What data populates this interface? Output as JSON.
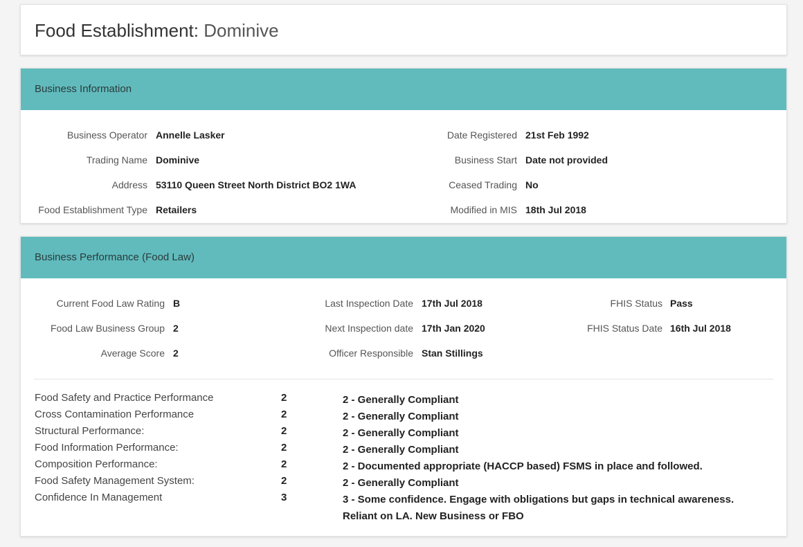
{
  "page": {
    "title_prefix": "Food Establishment:",
    "title_name": "Dominive"
  },
  "business_info": {
    "heading": "Business Information",
    "left": [
      {
        "label": "Business Operator",
        "value": "Annelle Lasker"
      },
      {
        "label": "Trading Name",
        "value": "Dominive"
      },
      {
        "label": "Address",
        "value": "53110 Queen Street North District BO2 1WA"
      },
      {
        "label": "Food Establishment Type",
        "value": "Retailers"
      }
    ],
    "right": [
      {
        "label": "Date Registered",
        "value": "21st Feb 1992"
      },
      {
        "label": "Business Start",
        "value": "Date not provided"
      },
      {
        "label": "Ceased Trading",
        "value": "No"
      },
      {
        "label": "Modified in MIS",
        "value": "18th Jul 2018"
      }
    ]
  },
  "performance": {
    "heading": "Business Performance (Food Law)",
    "col1": [
      {
        "label": "Current Food Law Rating",
        "value": "B"
      },
      {
        "label": "Food Law Business Group",
        "value": "2"
      },
      {
        "label": "Average Score",
        "value": "2"
      }
    ],
    "col2": [
      {
        "label": "Last Inspection Date",
        "value": "17th Jul 2018"
      },
      {
        "label": "Next Inspection date",
        "value": "17th Jan 2020"
      },
      {
        "label": "Officer Responsible",
        "value": "Stan Stillings"
      }
    ],
    "col3": [
      {
        "label": "FHIS Status",
        "value": "Pass"
      },
      {
        "label": "FHIS Status Date",
        "value": "16th Jul 2018"
      }
    ],
    "scores": [
      {
        "label": "Food Safety and Practice Performance",
        "score": "2",
        "description": "2 - Generally Compliant"
      },
      {
        "label": "Cross Contamination Performance",
        "score": "2",
        "description": "2 - Generally Compliant"
      },
      {
        "label": "Structural Performance:",
        "score": "2",
        "description": "2 - Generally Compliant"
      },
      {
        "label": "Food Information Performance:",
        "score": "2",
        "description": "2 - Generally Compliant"
      },
      {
        "label": "Composition Performance:",
        "score": "2",
        "description": "2 - Documented appropriate (HACCP based) FSMS in place and followed."
      },
      {
        "label": "Food Safety Management System:",
        "score": "2",
        "description": "2 - Generally Compliant"
      },
      {
        "label": "Confidence In Management",
        "score": "3",
        "description": "3 - Some confidence. Engage with obligations but gaps in technical awareness. Reliant on LA. New Business or FBO"
      }
    ]
  }
}
